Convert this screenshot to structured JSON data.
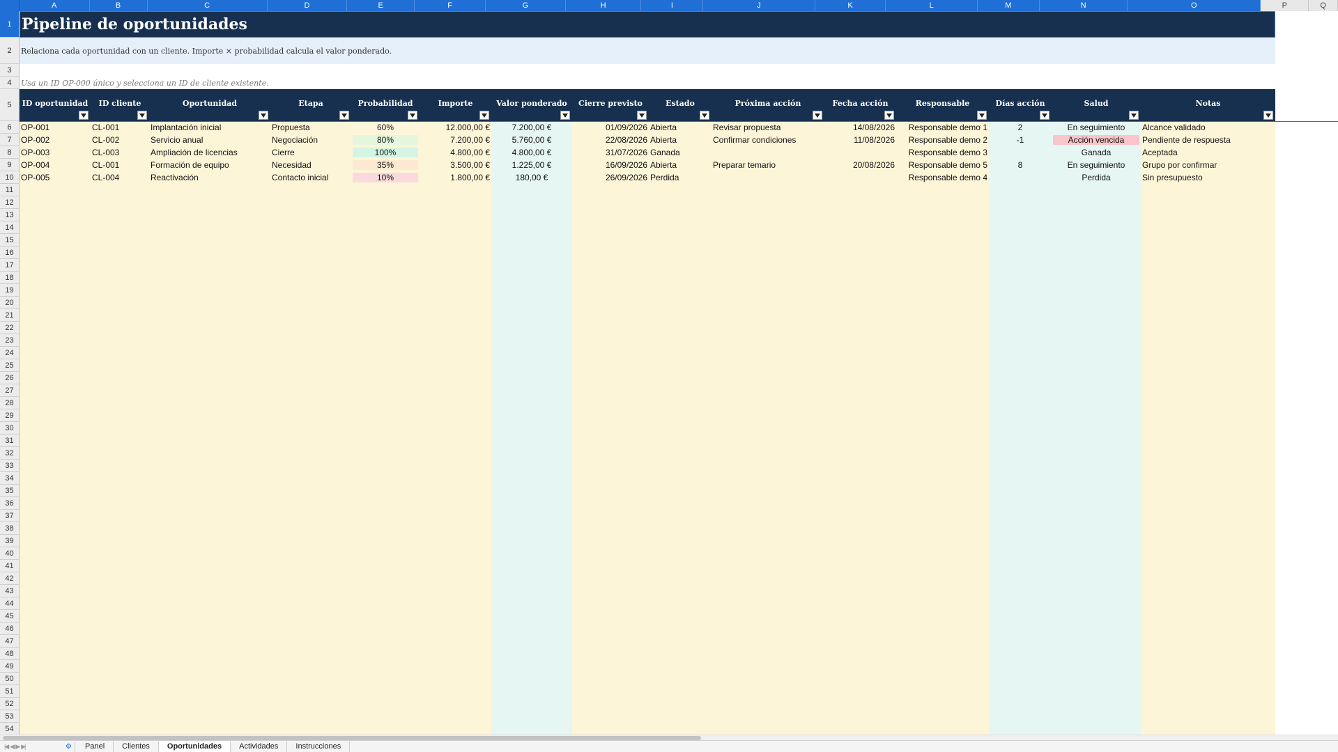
{
  "columns": [
    "A",
    "B",
    "C",
    "D",
    "E",
    "F",
    "G",
    "H",
    "I",
    "J",
    "K",
    "L",
    "M",
    "N",
    "O",
    "P",
    "Q"
  ],
  "rows": [
    "1",
    "2",
    "3",
    "4",
    "5",
    "6",
    "7",
    "8",
    "9",
    "10",
    "11",
    "12",
    "13",
    "14",
    "15",
    "16",
    "17",
    "18",
    "19",
    "20",
    "21",
    "22",
    "23",
    "24",
    "25",
    "26",
    "27",
    "28",
    "29",
    "30",
    "31",
    "32",
    "33",
    "34",
    "35",
    "36",
    "37",
    "38",
    "39",
    "40",
    "41",
    "42",
    "43",
    "44",
    "45",
    "46",
    "47",
    "48",
    "49",
    "50",
    "51",
    "52",
    "53",
    "54"
  ],
  "title": "Pipeline de oportunidades",
  "subtitle": "Relaciona cada oportunidad con un cliente. Importe × probabilidad calcula el valor ponderado.",
  "hint": "Usa un ID OP-000 único y selecciona un ID de cliente existente.",
  "headers": [
    "ID oportunidad",
    "ID cliente",
    "Oportunidad",
    "Etapa",
    "Probabilidad",
    "Importe",
    "Valor ponderado",
    "Cierre previsto",
    "Estado",
    "Próxima acción",
    "Fecha acción",
    "Responsable",
    "Días acción",
    "Salud",
    "Notas"
  ],
  "records": [
    {
      "id": "OP-001",
      "cliente": "CL-001",
      "oportunidad": "Implantación inicial",
      "etapa": "Propuesta",
      "probabilidad": "60%",
      "importe": "12.000,00 €",
      "ponderado": "7.200,00 €",
      "cierre": "01/09/2026",
      "estado": "Abierta",
      "accion": "Revisar propuesta",
      "fecha": "14/08/2026",
      "responsable": "Responsable demo 1",
      "dias": "2",
      "salud": "En seguimiento",
      "notas": "Alcance validado"
    },
    {
      "id": "OP-002",
      "cliente": "CL-002",
      "oportunidad": "Servicio anual",
      "etapa": "Negociación",
      "probabilidad": "80%",
      "importe": "7.200,00 €",
      "ponderado": "5.760,00 €",
      "cierre": "22/08/2026",
      "estado": "Abierta",
      "accion": "Confirmar condiciones",
      "fecha": "11/08/2026",
      "responsable": "Responsable demo 2",
      "dias": "-1",
      "salud": "Acción vencida",
      "notas": "Pendiente de respuesta"
    },
    {
      "id": "OP-003",
      "cliente": "CL-003",
      "oportunidad": "Ampliación de licencias",
      "etapa": "Cierre",
      "probabilidad": "100%",
      "importe": "4.800,00 €",
      "ponderado": "4.800,00 €",
      "cierre": "31/07/2026",
      "estado": "Ganada",
      "accion": "",
      "fecha": "",
      "responsable": "Responsable demo 3",
      "dias": "",
      "salud": "Ganada",
      "notas": "Aceptada"
    },
    {
      "id": "OP-004",
      "cliente": "CL-001",
      "oportunidad": "Formación de equipo",
      "etapa": "Necesidad",
      "probabilidad": "35%",
      "importe": "3.500,00 €",
      "ponderado": "1.225,00 €",
      "cierre": "16/09/2026",
      "estado": "Abierta",
      "accion": "Preparar temario",
      "fecha": "20/08/2026",
      "responsable": "Responsable demo 5",
      "dias": "8",
      "salud": "En seguimiento",
      "notas": "Grupo por confirmar"
    },
    {
      "id": "OP-005",
      "cliente": "CL-004",
      "oportunidad": "Reactivación",
      "etapa": "Contacto inicial",
      "probabilidad": "10%",
      "importe": "1.800,00 €",
      "ponderado": "180,00 €",
      "cierre": "26/09/2026",
      "estado": "Perdida",
      "accion": "",
      "fecha": "",
      "responsable": "Responsable demo 4",
      "dias": "",
      "salud": "Perdida",
      "notas": "Sin presupuesto"
    }
  ],
  "colors": {
    "header_bg": "#17304f",
    "selection": "#1f6fd6",
    "input_bg": "#fdf5d8",
    "formula_bg": "#e6f6f2",
    "prob_60": "#fdf6dc",
    "prob_80": "#e4f6dc",
    "prob_100": "#d4f4e4",
    "prob_35": "#fde9cf",
    "prob_10": "#fadadd",
    "overdue": "#f9c5c8"
  },
  "tabs": {
    "items": [
      "Panel",
      "Clientes",
      "Oportunidades",
      "Actividades",
      "Instrucciones"
    ],
    "active": "Oportunidades"
  }
}
